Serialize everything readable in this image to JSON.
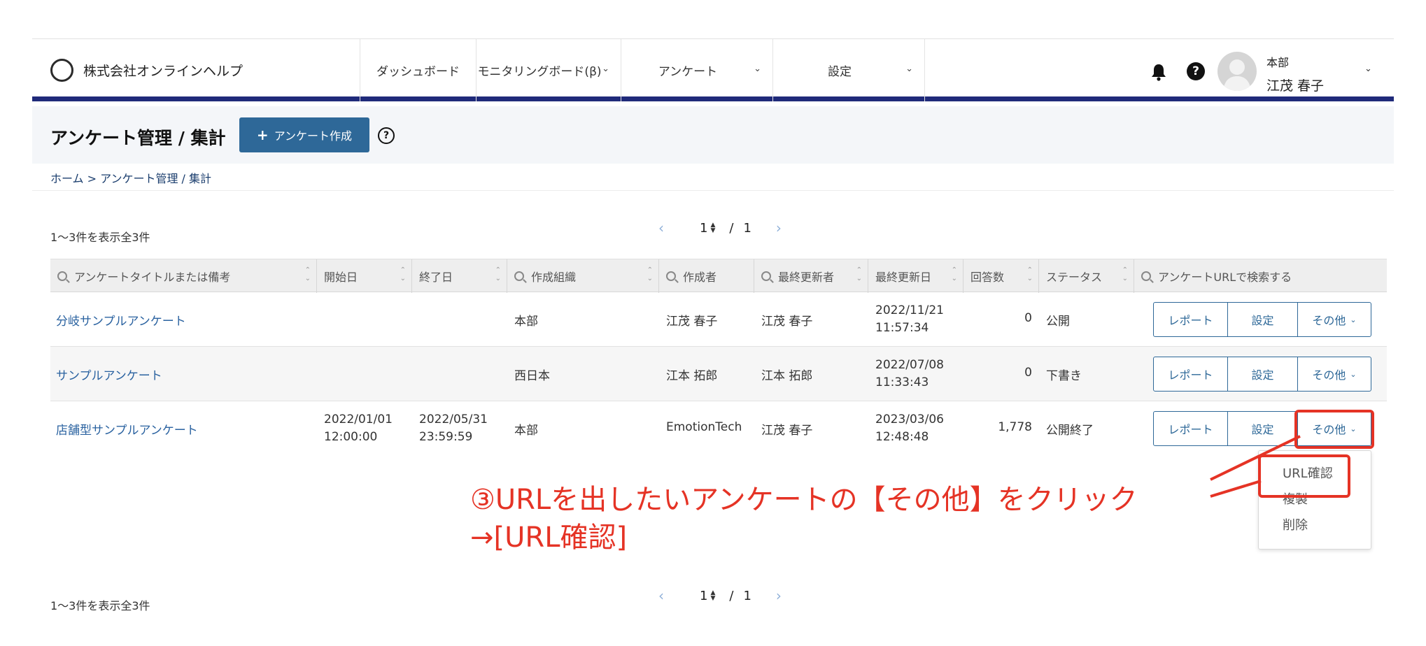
{
  "header": {
    "company": "株式会社オンラインヘルプ",
    "nav": [
      {
        "label": "ダッシュボード"
      },
      {
        "label": "モニタリングボード(β)"
      },
      {
        "label": "アンケート"
      },
      {
        "label": "設定"
      }
    ],
    "user": {
      "dept": "本部",
      "name": "江茂 春子"
    },
    "help_glyph": "?"
  },
  "titlebar": {
    "title": "アンケート管理 / 集計",
    "create_label": "アンケート作成",
    "help_glyph": "?"
  },
  "breadcrumb": {
    "home": "ホーム",
    "sep": " > ",
    "current": "アンケート管理 / 集計"
  },
  "summary": {
    "count_text": "1〜3件を表示全3件"
  },
  "pager": {
    "current": "1",
    "sep": "/",
    "total": "1",
    "prev": "‹",
    "next": "›"
  },
  "table": {
    "search_headers": {
      "title": "アンケートタイトルまたは備考",
      "org": "作成組織",
      "creator": "作成者",
      "updater": "最終更新者",
      "url": "アンケートURLで検索する"
    },
    "headers": {
      "start": "開始日",
      "end": "終了日",
      "updated": "最終更新日",
      "answers": "回答数",
      "status": "ステータス"
    },
    "rows": [
      {
        "title": "分岐サンプルアンケート",
        "start_date": "",
        "start_time": "",
        "end_date": "",
        "end_time": "",
        "org": "本部",
        "creator": "江茂 春子",
        "updater": "江茂 春子",
        "updated_date": "2022/11/21",
        "updated_time": "11:57:34",
        "answers": "0",
        "status": "公開"
      },
      {
        "title": "サンプルアンケート",
        "start_date": "",
        "start_time": "",
        "end_date": "",
        "end_time": "",
        "org": "西日本",
        "creator": "江本 拓郎",
        "updater": "江本 拓郎",
        "updated_date": "2022/07/08",
        "updated_time": "11:33:43",
        "answers": "0",
        "status": "下書き"
      },
      {
        "title": "店舗型サンプルアンケート",
        "start_date": "2022/01/01",
        "start_time": "12:00:00",
        "end_date": "2022/05/31",
        "end_time": "23:59:59",
        "org": "本部",
        "creator": "EmotionTech",
        "updater": "江茂 春子",
        "updated_date": "2023/03/06",
        "updated_time": "12:48:48",
        "answers": "1,778",
        "status": "公開終了"
      }
    ],
    "actions": {
      "report": "レポート",
      "settings": "設定",
      "other": "その他"
    }
  },
  "dropdown": {
    "items": [
      "URL確認",
      "複製",
      "削除"
    ]
  },
  "annotation": {
    "line1": "③URLを出したいアンケートの【その他】をクリック",
    "line2": "→[URL確認]"
  },
  "colors": {
    "accent": "#2e6898",
    "navy_bar": "#1f2a7a",
    "annotation_red": "#e53325",
    "link": "#2a62a0"
  }
}
